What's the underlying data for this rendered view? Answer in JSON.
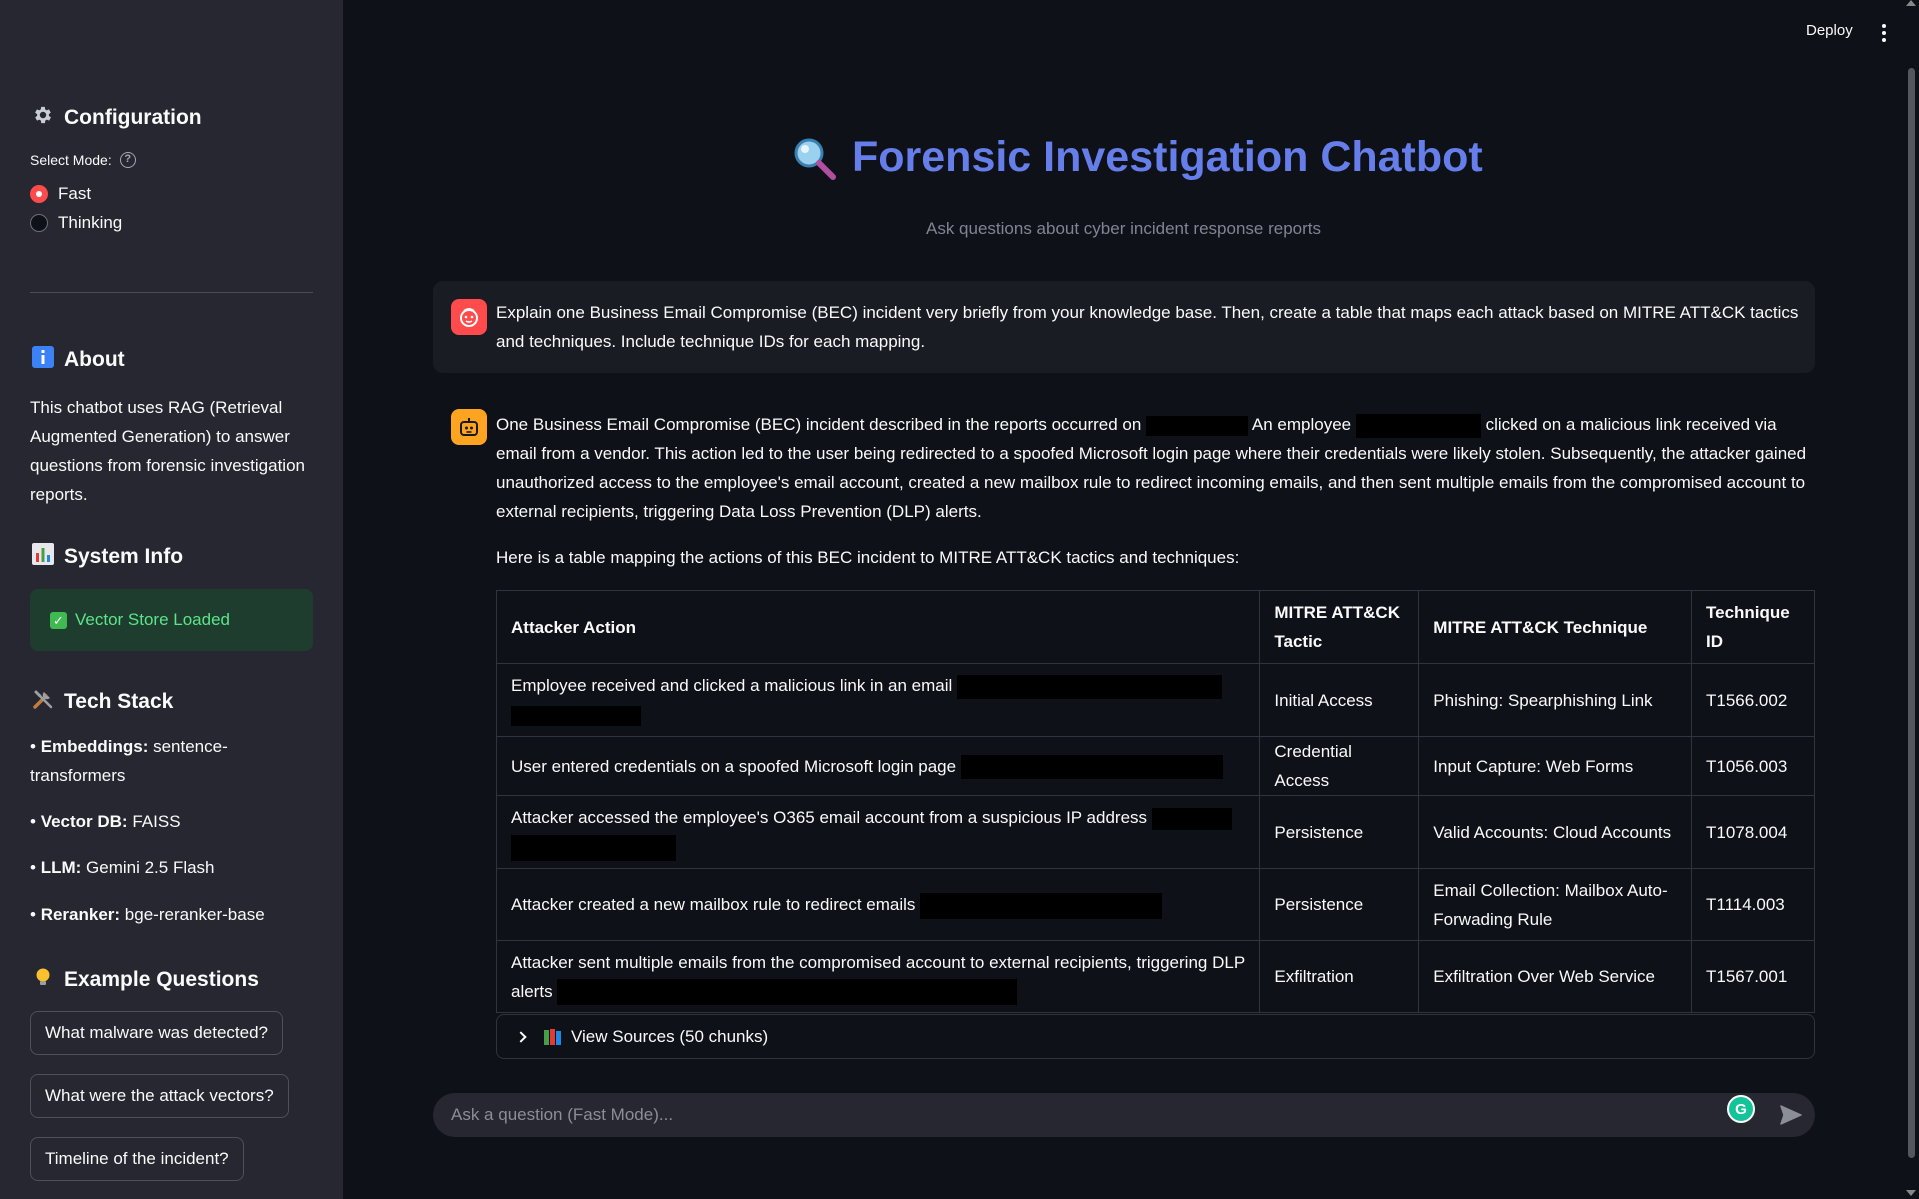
{
  "sidebar": {
    "configuration_title": "Configuration",
    "select_mode_label": "Select Mode:",
    "modes": [
      {
        "label": "Fast",
        "selected": true
      },
      {
        "label": "Thinking",
        "selected": false
      }
    ],
    "about_title": "About",
    "about_text": "This chatbot uses RAG (Retrieval Augmented Generation) to answer questions from forensic investigation reports.",
    "system_info_title": "System Info",
    "status_text": "Vector Store Loaded",
    "tech_stack_title": "Tech Stack",
    "tech_stack": [
      {
        "key": "Embeddings:",
        "value": "sentence-transformers"
      },
      {
        "key": "Vector DB:",
        "value": "FAISS"
      },
      {
        "key": "LLM:",
        "value": "Gemini 2.5 Flash"
      },
      {
        "key": "Reranker:",
        "value": "bge-reranker-base"
      }
    ],
    "example_questions_title": "Example Questions",
    "example_questions": [
      "What malware was detected?",
      "What were the attack vectors?",
      "Timeline of the incident?"
    ]
  },
  "topbar": {
    "deploy_label": "Deploy"
  },
  "main": {
    "title": "Forensic Investigation Chatbot",
    "subtitle": "Ask questions about cyber incident response reports",
    "user_message": "Explain one Business Email Compromise (BEC) incident very briefly from your knowledge base. Then, create a table that maps each attack based on MITRE ATT&CK tactics and techniques. Include technique IDs for each mapping.",
    "assistant": {
      "para1_a": "One Business Email Compromise (BEC) incident described in the reports occurred on",
      "para1_b": "An employee",
      "para1_c": "clicked on a malicious link received via email from a vendor. This action led to the user being redirected to a spoofed Microsoft login page where their credentials were likely stolen. Subsequently, the attacker gained unauthorized access to the employee's email account, created a new mailbox rule to redirect incoming emails, and then sent multiple emails from the compromised account to external recipients, triggering Data Loss Prevention (DLP) alerts.",
      "para2": "Here is a table mapping the actions of this BEC incident to MITRE ATT&CK tactics and techniques:",
      "table_headers": [
        "Attacker Action",
        "MITRE ATT&CK Tactic",
        "MITRE ATT&CK Technique",
        "Technique ID"
      ],
      "table_rows": [
        [
          "Employee received and clicked a malicious link in an email",
          "Initial Access",
          "Phishing: Spearphishing Link",
          "T1566.002"
        ],
        [
          "User entered credentials on a spoofed Microsoft login page",
          "Credential Access",
          "Input Capture: Web Forms",
          "T1056.003"
        ],
        [
          "Attacker accessed the employee's O365 email account from a suspicious IP address",
          "Persistence",
          "Valid Accounts: Cloud Accounts",
          "T1078.004"
        ],
        [
          "Attacker created a new mailbox rule to redirect emails",
          "Persistence",
          "Email Collection: Mailbox Auto-Forwading Rule",
          "T1114.003"
        ],
        [
          "Attacker sent multiple emails from the compromised account to external recipients, triggering DLP alerts",
          "Exfiltration",
          "Exfiltration Over Web Service",
          "T1567.001"
        ]
      ],
      "sources_label": "View Sources (50 chunks)"
    },
    "chat_placeholder": "Ask a question (Fast Mode)...",
    "grammarly_letter": "G"
  },
  "colors": {
    "accent_title": "#667eea",
    "radio_selected": "#ff4b4b",
    "success_text": "#5ce488",
    "user_avatar": "#ff4b4b",
    "assistant_avatar": "#ffa421"
  }
}
